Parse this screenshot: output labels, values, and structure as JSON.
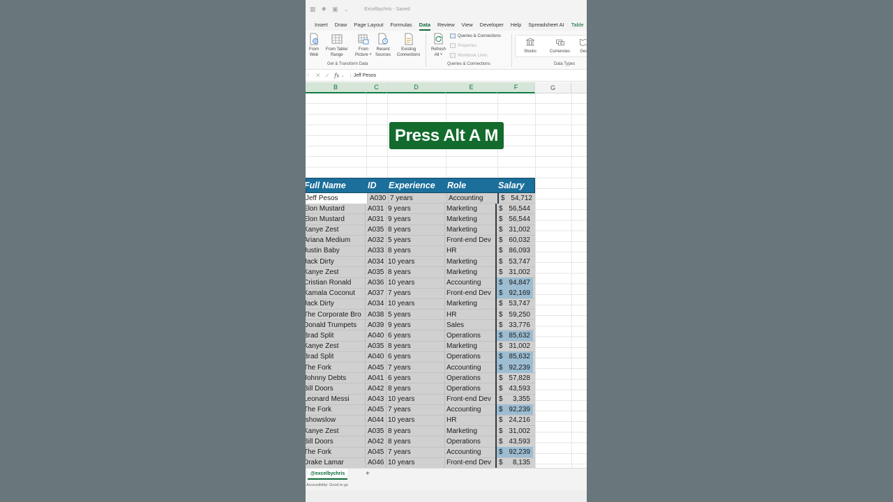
{
  "titlebar": {
    "doc_title": "Excelbychris - Saved"
  },
  "tabs": [
    "Insert",
    "Draw",
    "Page Layout",
    "Formulas",
    "Data",
    "Review",
    "View",
    "Developer",
    "Help",
    "Spreadsheet AI",
    "Table"
  ],
  "active_tab": "Data",
  "ribbon": {
    "from_web": [
      "From",
      "Web"
    ],
    "from_table": [
      "From Table/",
      "Range"
    ],
    "from_picture": [
      "From",
      "Picture ˅"
    ],
    "recent_sources": [
      "Recent",
      "Sources"
    ],
    "existing_connections": [
      "Existing",
      "Connections"
    ],
    "group_get_transform": "Get & Transform Data",
    "refresh_all": [
      "Refresh",
      "All ˅"
    ],
    "queries_connections_btn": "Queries & Connections",
    "properties_btn": "Properties",
    "workbook_links_btn": "Workbook Links",
    "group_queries": "Queries & Connections",
    "stocks": "Stocks",
    "currencies": "Currencies",
    "geography_partial": "Geo",
    "group_data_types": "Data Types"
  },
  "formula_bar": {
    "fx": "fx",
    "value": "Jeff Pesos"
  },
  "columns": [
    "B",
    "C",
    "D",
    "E",
    "F",
    "G"
  ],
  "overlay_text": "Press Alt A M",
  "table": {
    "headers": [
      "Full Name",
      "ID",
      "Experience",
      "Role",
      "Salary"
    ],
    "rows": [
      [
        "Jeff Pesos",
        "A030",
        "7 years",
        "Accounting",
        "54,712"
      ],
      [
        "Elon Mustard",
        "A031",
        "9 years",
        "Marketing",
        "56,544"
      ],
      [
        "Elon Mustard",
        "A031",
        "9 years",
        "Marketing",
        "56,544"
      ],
      [
        "Kanye Zest",
        "A035",
        "8 years",
        "Marketing",
        "31,002"
      ],
      [
        "Ariana Medium",
        "A032",
        "5 years",
        "Front-end Dev",
        "60,032"
      ],
      [
        "Justin Baby",
        "A033",
        "8 years",
        "HR",
        "86,093"
      ],
      [
        "Jack Dirty",
        "A034",
        "10 years",
        "Marketing",
        "53,747"
      ],
      [
        "Kanye Zest",
        "A035",
        "8 years",
        "Marketing",
        "31,002"
      ],
      [
        "Cristian Ronald",
        "A036",
        "10 years",
        "Accounting",
        "94,847"
      ],
      [
        "Kamala Coconut",
        "A037",
        "7 years",
        "Front-end Dev",
        "92,169"
      ],
      [
        "Jack Dirty",
        "A034",
        "10 years",
        "Marketing",
        "53,747"
      ],
      [
        "The Corporate Bro",
        "A038",
        "5 years",
        "HR",
        "59,250"
      ],
      [
        "Donald Trumpets",
        "A039",
        "9 years",
        "Sales",
        "33,776"
      ],
      [
        "Brad Split",
        "A040",
        "6 years",
        "Operations",
        "85,632"
      ],
      [
        "Kanye Zest",
        "A035",
        "8 years",
        "Marketing",
        "31,002"
      ],
      [
        "Brad Split",
        "A040",
        "6 years",
        "Operations",
        "85,632"
      ],
      [
        "The Fork",
        "A045",
        "7 years",
        "Accounting",
        "92,239"
      ],
      [
        "Johnny Debts",
        "A041",
        "6 years",
        "Operations",
        "57,828"
      ],
      [
        "Bill Doors",
        "A042",
        "8 years",
        "Operations",
        "43,593"
      ],
      [
        "Leonard Messi",
        "A043",
        "10 years",
        "Front-end Dev",
        "3,355"
      ],
      [
        "The Fork",
        "A045",
        "7 years",
        "Accounting",
        "92,239"
      ],
      [
        "Ishowslow",
        "A044",
        "10 years",
        "HR",
        "24,216"
      ],
      [
        "Kanye Zest",
        "A035",
        "8 years",
        "Marketing",
        "31,002"
      ],
      [
        "Bill Doors",
        "A042",
        "8 years",
        "Operations",
        "43,593"
      ],
      [
        "The Fork",
        "A045",
        "7 years",
        "Accounting",
        "92,239"
      ],
      [
        "Drake Lamar",
        "A046",
        "10 years",
        "Front-end Dev",
        "8,135"
      ]
    ],
    "salary_highlight": [
      false,
      false,
      false,
      false,
      false,
      false,
      false,
      false,
      true,
      true,
      false,
      false,
      false,
      true,
      false,
      true,
      true,
      false,
      false,
      false,
      true,
      false,
      false,
      false,
      true,
      false
    ],
    "currency_symbol": "$"
  },
  "sheet_tab": "@excelbychris",
  "add_sheet": "+",
  "status": "Accessibility: Good to go",
  "colors": {
    "accent": "#107c41",
    "table_header": "#1b6f9a",
    "overlay": "#136b2d",
    "salary_highlight": "#9dbdd2"
  }
}
